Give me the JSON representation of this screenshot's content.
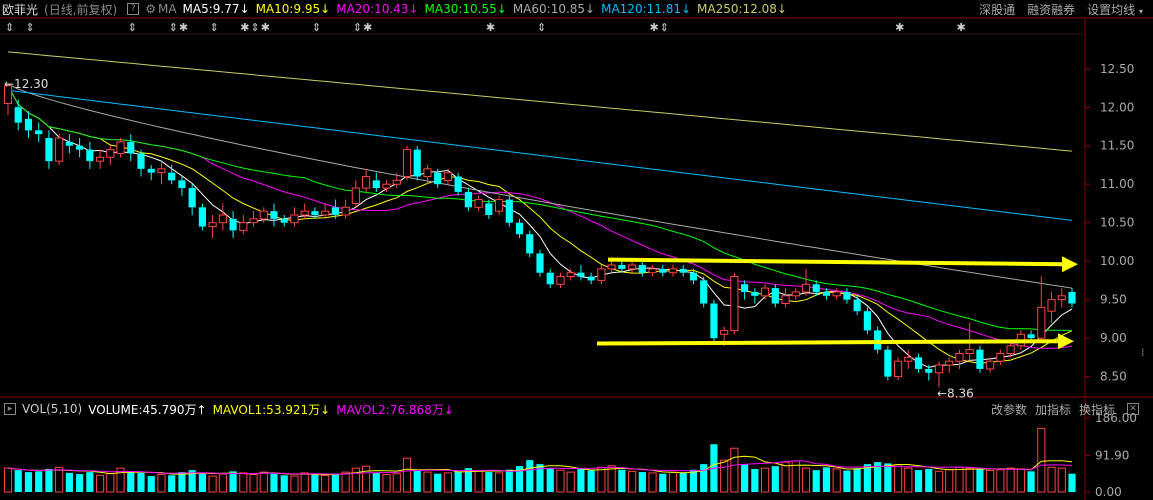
{
  "header": {
    "stock_name": "欧菲光",
    "period": "(日线,前复权)",
    "ma_label": "MA",
    "ma5": "MA5:9.77",
    "ma10": "MA10:9.95",
    "ma20": "MA20:10.43",
    "ma30": "MA30:10.55",
    "ma60": "MA60:10.85",
    "ma120": "MA120:11.81",
    "ma250": "MA250:12.08",
    "down_arrow": "↓",
    "links": [
      "深股通",
      "融资融券",
      "设置均线"
    ]
  },
  "volume_header": {
    "label": "VOL(5,10)",
    "volume": "VOLUME:45.790万",
    "volume_arrow": "↑",
    "mavol1": "MAVOL1:53.921万",
    "mavol2": "MAVOL2:76.868万",
    "down_arrow": "↓",
    "links": [
      "改参数",
      "加指标",
      "换指标"
    ]
  },
  "colors": {
    "up": "#ff4444",
    "down": "#00ffff",
    "ma5": "#ffffff",
    "ma10": "#ffff00",
    "ma20": "#ff00ff",
    "ma30": "#00ff00",
    "ma60": "#aaaaaa",
    "ma120": "#00bfff",
    "ma250": "#cccc66",
    "arrow": "#ffff00"
  },
  "chart_data": {
    "type": "candlestick",
    "price_axis": {
      "ticks": [
        "12.50",
        "12.00",
        "11.50",
        "11.00",
        "10.50",
        "10.00",
        "9.50",
        "9.00",
        "8.50"
      ],
      "ylim": [
        8.3,
        12.9
      ]
    },
    "volume_axis": {
      "ticks": [
        "186.00",
        "91.90",
        "0.00"
      ],
      "ylim": [
        0,
        186
      ]
    },
    "annotations": {
      "high": "12.30",
      "low": "8.36"
    },
    "candles": [
      [
        12.05,
        12.28,
        12.3,
        11.9
      ],
      [
        12.0,
        11.8,
        12.1,
        11.7
      ],
      [
        11.85,
        11.7,
        11.95,
        11.6
      ],
      [
        11.7,
        11.65,
        11.8,
        11.55
      ],
      [
        11.6,
        11.3,
        11.7,
        11.2
      ],
      [
        11.3,
        11.6,
        11.65,
        11.25
      ],
      [
        11.55,
        11.5,
        11.65,
        11.4
      ],
      [
        11.5,
        11.45,
        11.6,
        11.35
      ],
      [
        11.45,
        11.3,
        11.55,
        11.2
      ],
      [
        11.3,
        11.35,
        11.45,
        11.2
      ],
      [
        11.35,
        11.45,
        11.5,
        11.25
      ],
      [
        11.4,
        11.55,
        11.6,
        11.35
      ],
      [
        11.55,
        11.4,
        11.65,
        11.3
      ],
      [
        11.4,
        11.2,
        11.45,
        11.1
      ],
      [
        11.2,
        11.15,
        11.25,
        11.05
      ],
      [
        11.15,
        11.2,
        11.3,
        11.0
      ],
      [
        11.15,
        11.05,
        11.25,
        11.0
      ],
      [
        11.05,
        10.95,
        11.1,
        10.85
      ],
      [
        10.95,
        10.7,
        11.0,
        10.6
      ],
      [
        10.7,
        10.45,
        10.75,
        10.4
      ],
      [
        10.45,
        10.5,
        10.6,
        10.3
      ],
      [
        10.5,
        10.6,
        10.75,
        10.4
      ],
      [
        10.55,
        10.4,
        10.65,
        10.3
      ],
      [
        10.4,
        10.5,
        10.6,
        10.35
      ],
      [
        10.5,
        10.55,
        10.65,
        10.45
      ],
      [
        10.55,
        10.65,
        10.7,
        10.5
      ],
      [
        10.65,
        10.55,
        10.75,
        10.45
      ],
      [
        10.55,
        10.5,
        10.6,
        10.45
      ],
      [
        10.5,
        10.6,
        10.7,
        10.45
      ],
      [
        10.6,
        10.65,
        10.75,
        10.55
      ],
      [
        10.65,
        10.6,
        10.7,
        10.55
      ],
      [
        10.6,
        10.65,
        10.75,
        10.55
      ],
      [
        10.7,
        10.6,
        10.8,
        10.55
      ],
      [
        10.6,
        10.7,
        10.8,
        10.55
      ],
      [
        10.75,
        10.95,
        11.05,
        10.7
      ],
      [
        10.95,
        11.1,
        11.2,
        10.9
      ],
      [
        11.05,
        10.95,
        11.15,
        10.9
      ],
      [
        10.95,
        11.0,
        11.05,
        10.9
      ],
      [
        11.0,
        11.05,
        11.15,
        10.95
      ],
      [
        11.1,
        11.45,
        11.5,
        11.05
      ],
      [
        11.45,
        11.1,
        11.5,
        11.05
      ],
      [
        11.1,
        11.2,
        11.25,
        11.0
      ],
      [
        11.15,
        11.0,
        11.2,
        10.95
      ],
      [
        11.05,
        11.15,
        11.2,
        11.0
      ],
      [
        11.1,
        10.9,
        11.15,
        10.85
      ],
      [
        10.9,
        10.7,
        10.95,
        10.65
      ],
      [
        10.7,
        10.8,
        10.85,
        10.65
      ],
      [
        10.75,
        10.6,
        10.8,
        10.55
      ],
      [
        10.65,
        10.8,
        10.85,
        10.6
      ],
      [
        10.8,
        10.5,
        10.85,
        10.45
      ],
      [
        10.5,
        10.35,
        10.55,
        10.3
      ],
      [
        10.35,
        10.1,
        10.4,
        10.05
      ],
      [
        10.1,
        9.85,
        10.15,
        9.8
      ],
      [
        9.85,
        9.7,
        9.9,
        9.65
      ],
      [
        9.7,
        9.8,
        9.85,
        9.65
      ],
      [
        9.8,
        9.85,
        9.9,
        9.75
      ],
      [
        9.85,
        9.8,
        9.95,
        9.75
      ],
      [
        9.8,
        9.75,
        9.85,
        9.7
      ],
      [
        9.75,
        9.9,
        9.95,
        9.7
      ],
      [
        9.9,
        9.95,
        10.0,
        9.85
      ],
      [
        9.95,
        9.9,
        10.0,
        9.85
      ],
      [
        9.9,
        9.95,
        10.0,
        9.85
      ],
      [
        9.95,
        9.85,
        10.0,
        9.8
      ],
      [
        9.85,
        9.9,
        9.95,
        9.8
      ],
      [
        9.9,
        9.85,
        9.95,
        9.8
      ],
      [
        9.85,
        9.9,
        9.95,
        9.8
      ],
      [
        9.9,
        9.85,
        9.95,
        9.8
      ],
      [
        9.85,
        9.75,
        9.9,
        9.7
      ],
      [
        9.75,
        9.45,
        9.8,
        9.4
      ],
      [
        9.45,
        9.0,
        9.5,
        8.95
      ],
      [
        9.05,
        9.1,
        9.15,
        8.9
      ],
      [
        9.1,
        9.8,
        9.85,
        9.05
      ],
      [
        9.7,
        9.6,
        9.75,
        9.5
      ],
      [
        9.6,
        9.55,
        9.65,
        9.45
      ],
      [
        9.55,
        9.65,
        9.7,
        9.5
      ],
      [
        9.65,
        9.45,
        9.7,
        9.4
      ],
      [
        9.45,
        9.55,
        9.65,
        9.4
      ],
      [
        9.55,
        9.6,
        9.65,
        9.5
      ],
      [
        9.6,
        9.7,
        9.9,
        9.55
      ],
      [
        9.7,
        9.6,
        9.75,
        9.55
      ],
      [
        9.6,
        9.55,
        9.65,
        9.5
      ],
      [
        9.55,
        9.6,
        9.65,
        9.5
      ],
      [
        9.6,
        9.5,
        9.65,
        9.45
      ],
      [
        9.5,
        9.35,
        9.55,
        9.3
      ],
      [
        9.35,
        9.1,
        9.4,
        9.05
      ],
      [
        9.1,
        8.85,
        9.15,
        8.8
      ],
      [
        8.85,
        8.5,
        8.9,
        8.45
      ],
      [
        8.5,
        8.7,
        8.75,
        8.45
      ],
      [
        8.7,
        8.75,
        8.85,
        8.6
      ],
      [
        8.75,
        8.6,
        8.8,
        8.55
      ],
      [
        8.6,
        8.55,
        8.65,
        8.45
      ],
      [
        8.55,
        8.65,
        8.7,
        8.36
      ],
      [
        8.65,
        8.7,
        8.75,
        8.55
      ],
      [
        8.7,
        8.8,
        8.85,
        8.6
      ],
      [
        8.8,
        8.85,
        9.2,
        8.7
      ],
      [
        8.85,
        8.6,
        8.9,
        8.55
      ],
      [
        8.6,
        8.7,
        8.75,
        8.55
      ],
      [
        8.7,
        8.8,
        8.85,
        8.65
      ],
      [
        8.8,
        8.9,
        8.95,
        8.75
      ],
      [
        8.9,
        9.05,
        9.1,
        8.85
      ],
      [
        9.05,
        9.0,
        9.1,
        8.95
      ],
      [
        9.0,
        9.4,
        9.8,
        8.95
      ],
      [
        9.35,
        9.5,
        9.6,
        9.2
      ],
      [
        9.5,
        9.55,
        9.65,
        9.4
      ],
      [
        9.6,
        9.45,
        9.65,
        9.4
      ]
    ],
    "volumes": [
      60,
      55,
      50,
      52,
      58,
      62,
      48,
      45,
      50,
      42,
      46,
      60,
      52,
      48,
      40,
      44,
      42,
      50,
      55,
      46,
      40,
      45,
      52,
      48,
      44,
      50,
      46,
      42,
      40,
      48,
      44,
      42,
      46,
      50,
      60,
      65,
      48,
      44,
      46,
      85,
      55,
      50,
      46,
      48,
      52,
      60,
      54,
      50,
      48,
      56,
      65,
      80,
      70,
      60,
      55,
      50,
      58,
      54,
      62,
      66,
      56,
      52,
      50,
      48,
      46,
      50,
      48,
      56,
      70,
      120,
      80,
      110,
      70,
      58,
      60,
      65,
      75,
      78,
      60,
      55,
      62,
      58,
      54,
      60,
      70,
      75,
      72,
      68,
      60,
      55,
      58,
      52,
      56,
      62,
      60,
      58,
      54,
      56,
      60,
      58,
      52,
      160,
      62,
      60,
      46
    ]
  }
}
